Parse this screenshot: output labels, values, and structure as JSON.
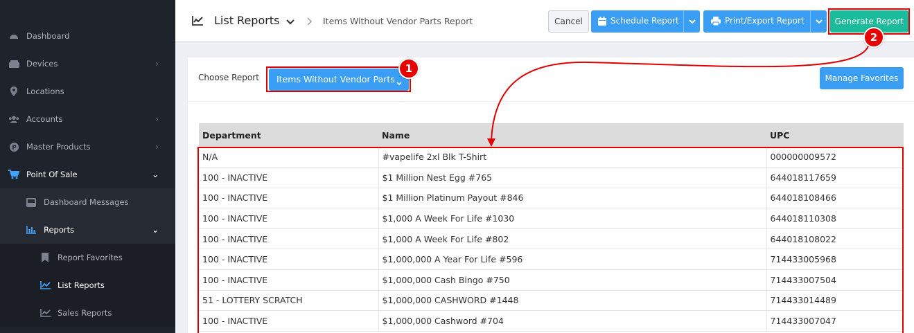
{
  "sidebar": {
    "items": [
      {
        "label": "Dashboard",
        "icon": "speedometer-icon"
      },
      {
        "label": "Devices",
        "icon": "device-icon"
      },
      {
        "label": "Locations",
        "icon": "location-pin-icon"
      },
      {
        "label": "Accounts",
        "icon": "users-icon"
      },
      {
        "label": "Master Products",
        "icon": "product-p-icon"
      },
      {
        "label": "Point Of Sale",
        "icon": "cart-icon"
      },
      {
        "label": "Dashboard Messages",
        "icon": "inbox-icon"
      },
      {
        "label": "Reports",
        "icon": "bar-chart-icon"
      },
      {
        "label": "Report Favorites",
        "icon": "bookmark-icon"
      },
      {
        "label": "List Reports",
        "icon": "line-chart-icon"
      },
      {
        "label": "Sales Reports",
        "icon": "line-chart-icon"
      }
    ]
  },
  "header": {
    "title": "List Reports",
    "breadcrumb": "Items Without Vendor Parts Report",
    "cancel_label": "Cancel",
    "schedule_label": "Schedule Report",
    "print_label": "Print/Export Report",
    "generate_label": "Generate Report"
  },
  "report": {
    "choose_label": "Choose Report",
    "selected": "Items Without Vendor Parts",
    "manage_favorites_label": "Manage Favorites"
  },
  "table": {
    "columns": [
      "Department",
      "Name",
      "UPC"
    ],
    "rows": [
      [
        "N/A",
        "#vapelife 2xl Blk T-Shirt",
        "000000009572"
      ],
      [
        "100 - INACTIVE",
        "$1 Million Nest Egg #765",
        "644018117659"
      ],
      [
        "100 - INACTIVE",
        "$1 Million Platinum Payout #846",
        "644018108466"
      ],
      [
        "100 - INACTIVE",
        "$1,000 A Week For Life #1030",
        "644018110308"
      ],
      [
        "100 - INACTIVE",
        "$1,000 A Week For Life #802",
        "644018108022"
      ],
      [
        "100 - INACTIVE",
        "$1,000,000 A Year For Life #596",
        "714433005968"
      ],
      [
        "100 - INACTIVE",
        "$1,000,000 Cash Bingo #750",
        "714433007504"
      ],
      [
        "51 - LOTTERY SCRATCH",
        "$1,000,000 CASHWORD #1448",
        "714433014489"
      ],
      [
        "100 - INACTIVE",
        "$1,000,000 Cashword #704",
        "714433007047"
      ]
    ]
  },
  "annotations": {
    "step1": "1",
    "step2": "2"
  },
  "colors": {
    "sidebar_bg": "#1f232b",
    "primary_blue": "#3a9ef5",
    "generate_green": "#1bbc9b",
    "annotation_red": "#e00000"
  }
}
